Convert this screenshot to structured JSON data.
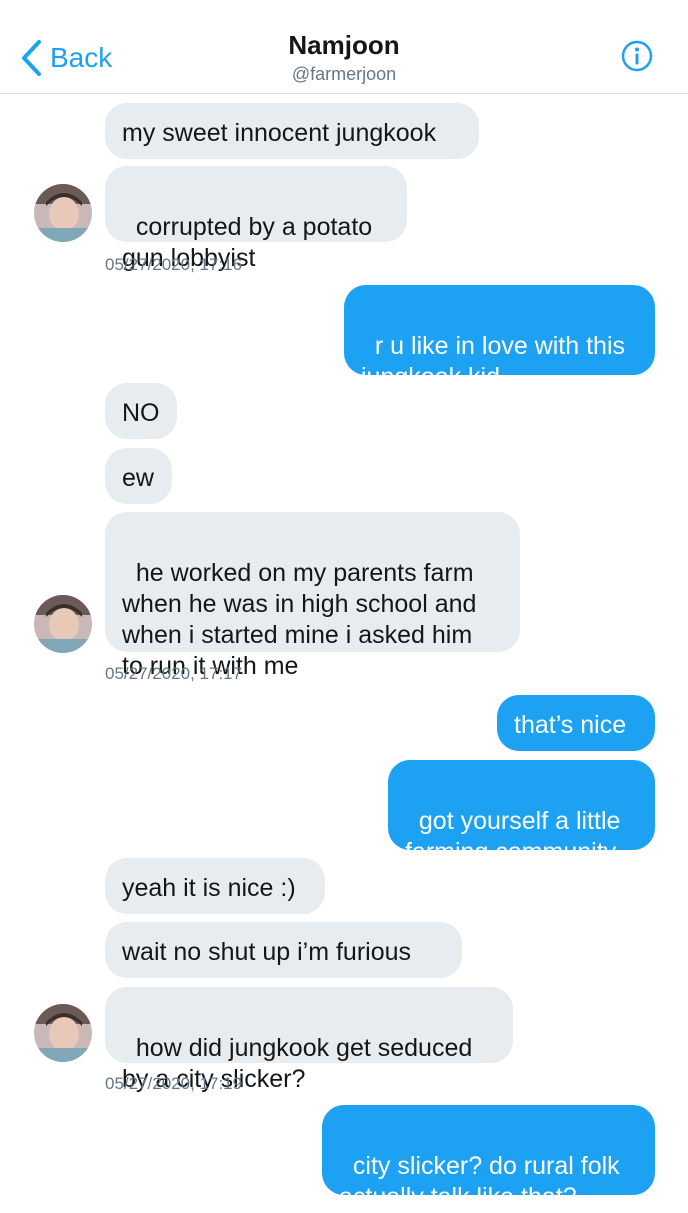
{
  "header": {
    "back_label": "Back",
    "title": "Namjoon",
    "handle": "@farmerjoon",
    "back_icon": "chevron-left-icon",
    "info_icon": "info-icon"
  },
  "colors": {
    "accent": "#1da1f2",
    "incoming_bubble": "#e6ecf0",
    "timestamp": "#657786"
  },
  "messages": [
    {
      "from": "them",
      "text": "my sweet innocent jungkook"
    },
    {
      "from": "them",
      "text": "corrupted by a potato\ngun lobbyist"
    },
    {
      "timestamp": "05/27/2020, 17:16"
    },
    {
      "from": "me",
      "text": "r u like in love with this\njungkook kid"
    },
    {
      "from": "them",
      "text": "NO"
    },
    {
      "from": "them",
      "text": "ew"
    },
    {
      "from": "them",
      "text": "he worked on my parents farm\nwhen he was in high school and\nwhen i started mine i asked him\nto run it with me"
    },
    {
      "timestamp": "05/27/2020, 17:17"
    },
    {
      "from": "me",
      "text": "that’s nice"
    },
    {
      "from": "me",
      "text": "got yourself a little\nfarming community"
    },
    {
      "from": "them",
      "text": "yeah it is nice :)"
    },
    {
      "from": "them",
      "text": "wait no shut up i’m furious"
    },
    {
      "from": "them",
      "text": "how did jungkook get seduced\nby a city slicker?"
    },
    {
      "timestamp": "05/27/2020, 17:19"
    },
    {
      "from": "me",
      "text": "city slicker? do rural folk\nactually talk like that?"
    }
  ]
}
